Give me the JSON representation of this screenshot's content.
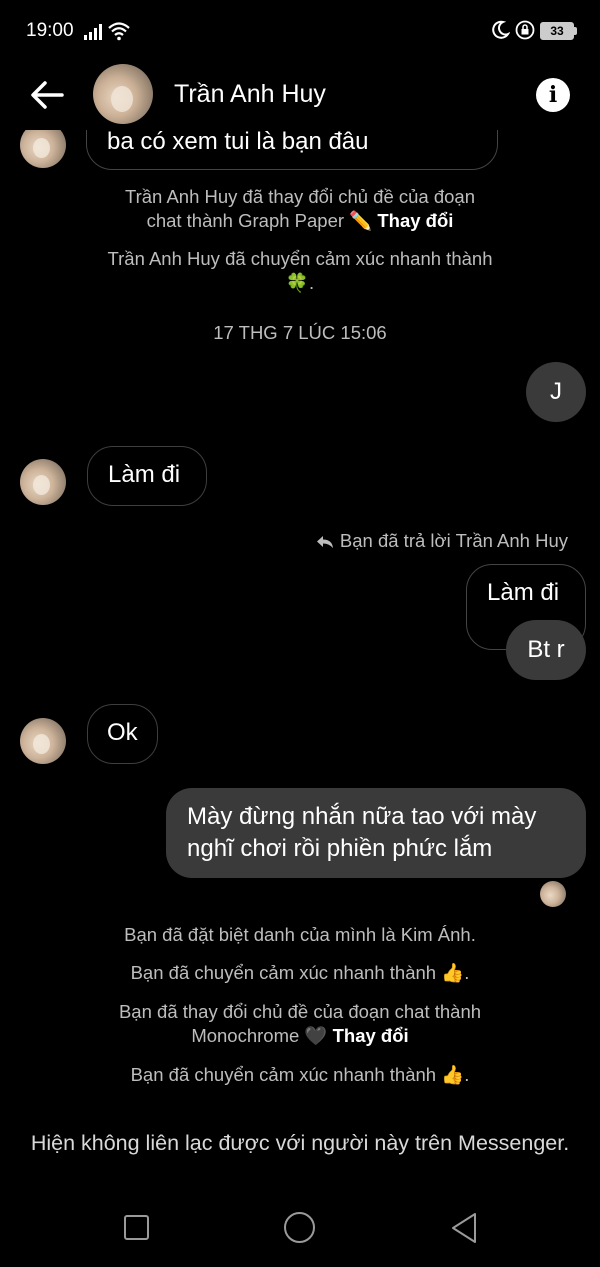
{
  "status_bar": {
    "time": "19:00",
    "battery": "33",
    "icons": [
      "signal-icon",
      "wifi-icon",
      "moon-icon",
      "lock-rotation-icon",
      "battery-icon"
    ]
  },
  "header": {
    "contact_name": "Trần Anh Huy",
    "back_icon": "arrow-left-icon",
    "info_icon": "info-icon",
    "info_glyph": "i"
  },
  "messages": {
    "partial_top": "ba có xem tui là bạn đâu",
    "sys1_line1": "Trần Anh Huy đã thay đổi chủ đề của đoạn",
    "sys1_line2": "chat thành Graph Paper",
    "sys1_emoji": "✏️",
    "sys1_action": "Thay đổi",
    "sys2_line1": "Trần Anh Huy đã chuyển cảm xúc nhanh thành",
    "sys2_emoji": "🍀",
    "sys2_tail": ".",
    "timestamp": "17 THG 7 LÚC 15:06",
    "out_j": "J",
    "in_lam_di": "Làm đi",
    "reply_note": "Bạn đã trả lời Trần Anh Huy",
    "quoted": "Làm đi",
    "out_bt": "Bt r",
    "in_ok": "Ok",
    "out_long_line1": "Mày đừng nhắn nữa tao với mày",
    "out_long_line2": "nghĩ chơi rồi phiền phức lắm",
    "sys3": "Bạn đã đặt biệt danh của mình là Kim Ánh.",
    "sys4_text": "Bạn đã chuyển cảm xúc nhanh thành",
    "sys4_emoji": "👍",
    "sys4_tail": ".",
    "sys5_line1": "Bạn đã thay đổi chủ đề của đoạn chat thành",
    "sys5_line2": "Monochrome",
    "sys5_emoji": "🖤",
    "sys5_action": "Thay đổi",
    "sys6_text": "Bạn đã chuyển cảm xúc nhanh thành",
    "sys6_emoji": "👍",
    "sys6_tail": "."
  },
  "footer": {
    "notice": "Hiện không liên lạc được với người này trên Messenger."
  },
  "nav_bar": {
    "icons": [
      "recent-apps-icon",
      "home-icon",
      "back-triangle-icon"
    ]
  },
  "colors": {
    "background": "#000000",
    "bubble_fill": "#3a3a3a",
    "bubble_outline": "#3e3e3e",
    "system_text": "#bdbdbd"
  }
}
